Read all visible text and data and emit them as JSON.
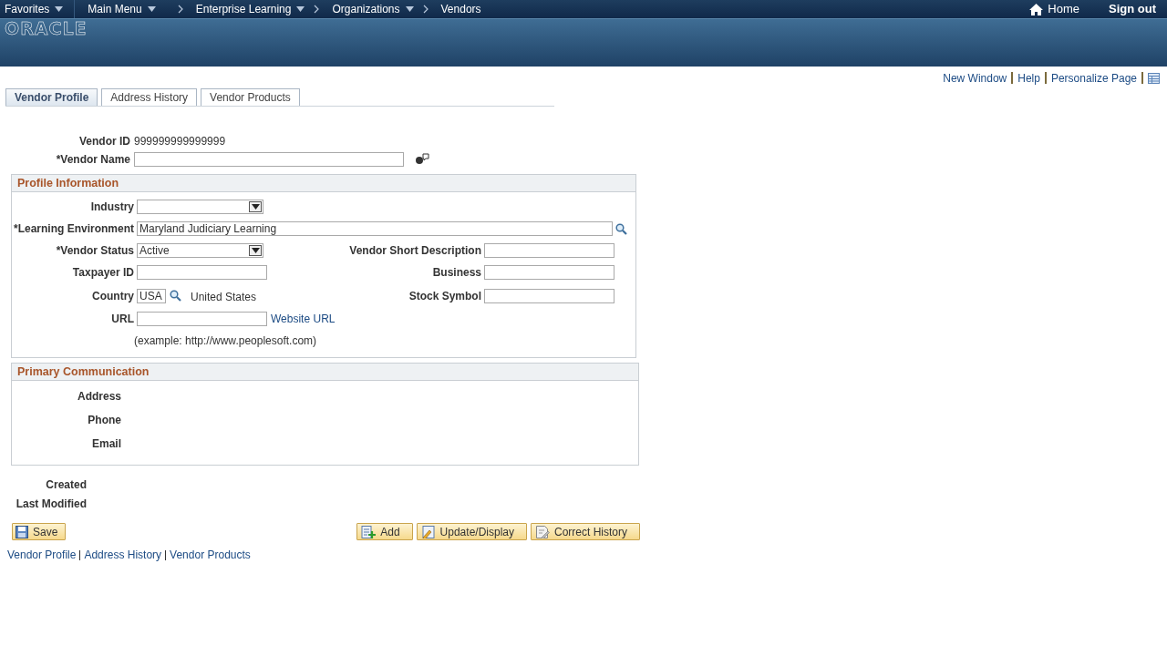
{
  "top_nav": {
    "menus": [
      {
        "label": "Favorites",
        "dropdown": true
      },
      {
        "label": "Main Menu",
        "dropdown": true
      }
    ],
    "breadcrumbs": [
      {
        "label": "Enterprise Learning",
        "dropdown": true
      },
      {
        "label": "Organizations",
        "dropdown": true
      },
      {
        "label": "Vendors",
        "dropdown": false
      }
    ],
    "home": "Home",
    "sign_out": "Sign out"
  },
  "logo": "ORACLE",
  "page_links": [
    "New Window",
    "Help",
    "Personalize Page"
  ],
  "tabs": [
    {
      "label": "Vendor Profile",
      "selected": true
    },
    {
      "label": "Address History",
      "selected": false
    },
    {
      "label": "Vendor Products",
      "selected": false
    }
  ],
  "vendor_id": {
    "label": "Vendor ID",
    "value": "999999999999999"
  },
  "vendor_name": {
    "label": "*Vendor Name"
  },
  "profile": {
    "title": "Profile Information",
    "rows": [
      {
        "left": {
          "kind": "select",
          "label": "Industry"
        }
      },
      {
        "left": {
          "kind": "lookup-wide",
          "label": "*Learning Environment",
          "value": "Maryland Judiciary Learning"
        }
      },
      {
        "left": {
          "kind": "select",
          "label": "*Vendor Status",
          "value": "Active"
        },
        "right": {
          "kind": "text",
          "label": "Vendor Short Description"
        }
      },
      {
        "left": {
          "kind": "text",
          "label": "Taxpayer ID"
        },
        "right": {
          "kind": "text",
          "label": "Business"
        }
      },
      {
        "left": {
          "kind": "lookup-code",
          "label": "Country",
          "value": "USA",
          "description": "United States"
        },
        "right": {
          "kind": "text",
          "label": "Stock Symbol"
        }
      },
      {
        "left": {
          "kind": "text",
          "label": "URL",
          "link": "Website URL"
        }
      }
    ],
    "hint": "(example: http://www.peoplesoft.com)"
  },
  "communication": {
    "title": "Primary Communication",
    "labels": [
      "Address",
      "Phone",
      "Email"
    ]
  },
  "audit_labels": [
    "Created",
    "Last Modified"
  ],
  "buttons": [
    {
      "kind": "save",
      "label": "Save"
    },
    {
      "kind": "add",
      "label": "Add"
    },
    {
      "kind": "update",
      "label": "Update/Display"
    },
    {
      "kind": "correct",
      "label": "Correct History"
    }
  ],
  "bottom_links": [
    "Vendor Profile",
    "Address History",
    "Vendor Products"
  ]
}
